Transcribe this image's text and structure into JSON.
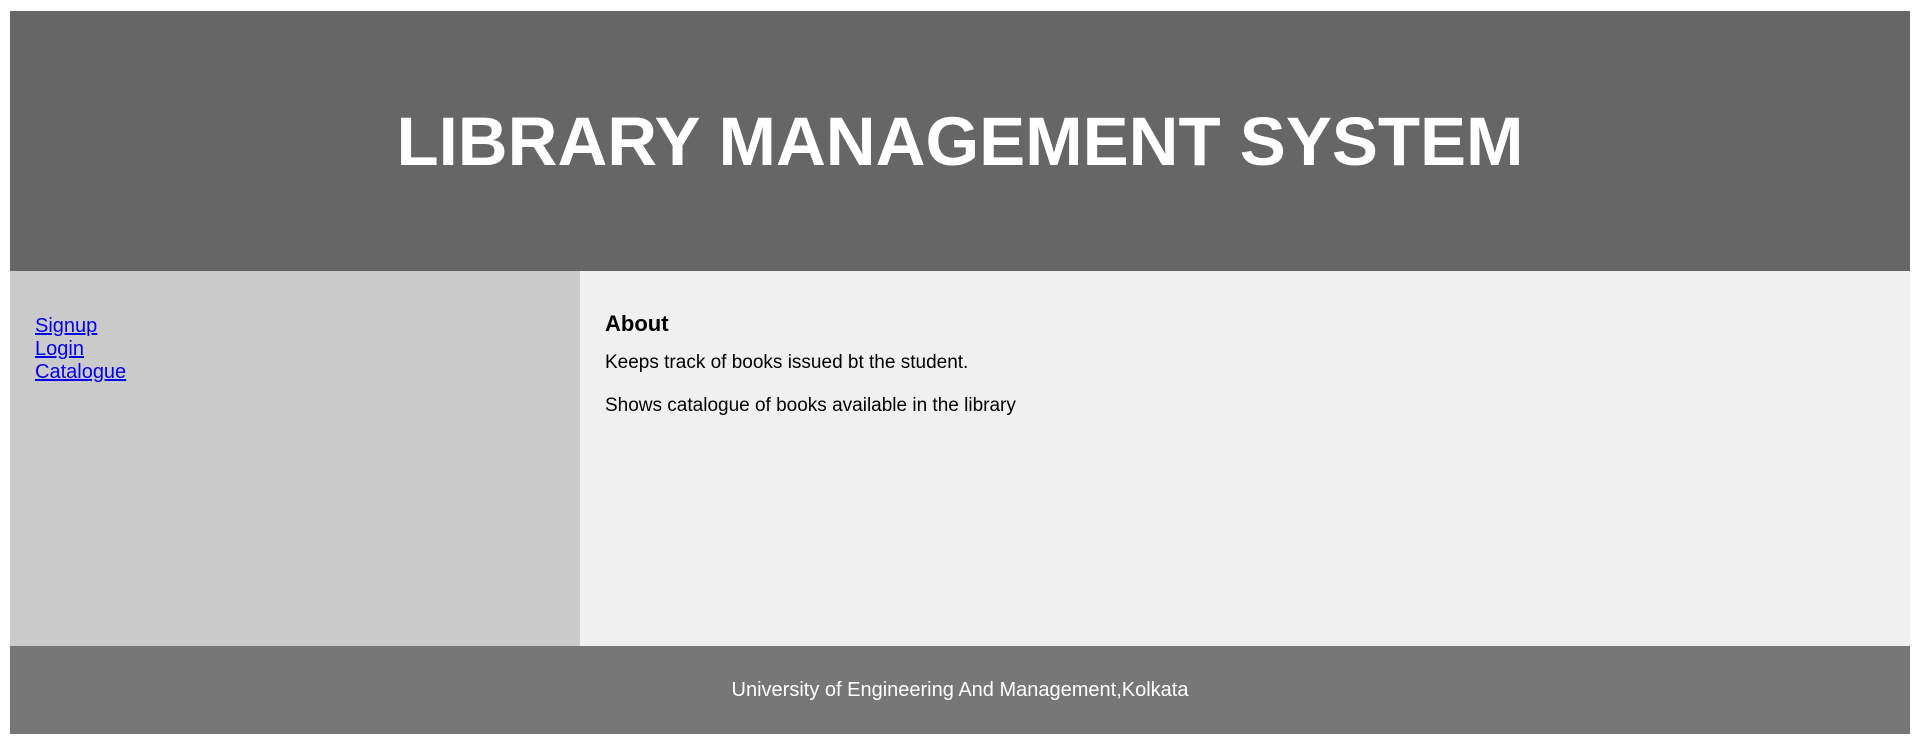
{
  "header": {
    "title": "LIBRARY MANAGEMENT SYSTEM"
  },
  "sidebar": {
    "links": [
      {
        "label": "Signup"
      },
      {
        "label": "Login"
      },
      {
        "label": "Catalogue"
      }
    ]
  },
  "main": {
    "heading": "About",
    "paragraphs": [
      "Keeps track of books issued bt the student.",
      "Shows catalogue of books available in the library"
    ]
  },
  "footer": {
    "text": "University of Engineering And Management,Kolkata"
  },
  "colors": {
    "header_bg": "#666666",
    "sidebar_bg": "#cacaca",
    "main_bg": "#f0f0f0",
    "footer_bg": "#777777",
    "link": "#0000ee"
  }
}
